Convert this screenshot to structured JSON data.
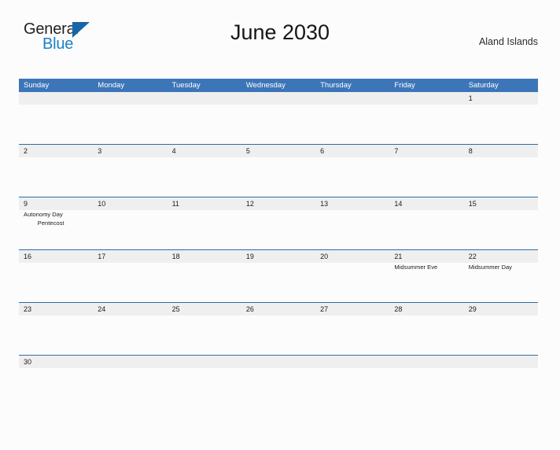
{
  "brand": {
    "name_part1": "General",
    "name_part2": "Blue",
    "triangle_color": "#1566a8",
    "blue_color": "#1c7fc4"
  },
  "header": {
    "title": "June 2030",
    "region": "Aland Islands"
  },
  "theme": {
    "header_blue": "#3d76b8",
    "rule_blue": "#2e6da4",
    "date_strip_gray": "#efefef",
    "page_background": "#fcfcfc"
  },
  "calendar": {
    "month": "June",
    "year": "2030",
    "weekday_headers": [
      "Sunday",
      "Monday",
      "Tuesday",
      "Wednesday",
      "Thursday",
      "Friday",
      "Saturday"
    ],
    "weeks": [
      {
        "days": [
          {
            "date": "",
            "events": []
          },
          {
            "date": "",
            "events": []
          },
          {
            "date": "",
            "events": []
          },
          {
            "date": "",
            "events": []
          },
          {
            "date": "",
            "events": []
          },
          {
            "date": "",
            "events": []
          },
          {
            "date": "1",
            "events": []
          }
        ]
      },
      {
        "days": [
          {
            "date": "2",
            "events": []
          },
          {
            "date": "3",
            "events": []
          },
          {
            "date": "4",
            "events": []
          },
          {
            "date": "5",
            "events": []
          },
          {
            "date": "6",
            "events": []
          },
          {
            "date": "7",
            "events": []
          },
          {
            "date": "8",
            "events": []
          }
        ]
      },
      {
        "days": [
          {
            "date": "9",
            "events": [
              "Autonomy Day",
              "Pentecost"
            ]
          },
          {
            "date": "10",
            "events": []
          },
          {
            "date": "11",
            "events": []
          },
          {
            "date": "12",
            "events": []
          },
          {
            "date": "13",
            "events": []
          },
          {
            "date": "14",
            "events": []
          },
          {
            "date": "15",
            "events": []
          }
        ]
      },
      {
        "days": [
          {
            "date": "16",
            "events": []
          },
          {
            "date": "17",
            "events": []
          },
          {
            "date": "18",
            "events": []
          },
          {
            "date": "19",
            "events": []
          },
          {
            "date": "20",
            "events": []
          },
          {
            "date": "21",
            "events": [
              "Midsummer Eve"
            ]
          },
          {
            "date": "22",
            "events": [
              "Midsummer Day"
            ]
          }
        ]
      },
      {
        "days": [
          {
            "date": "23",
            "events": []
          },
          {
            "date": "24",
            "events": []
          },
          {
            "date": "25",
            "events": []
          },
          {
            "date": "26",
            "events": []
          },
          {
            "date": "27",
            "events": []
          },
          {
            "date": "28",
            "events": []
          },
          {
            "date": "29",
            "events": []
          }
        ]
      },
      {
        "days": [
          {
            "date": "30",
            "events": []
          },
          {
            "date": "",
            "events": []
          },
          {
            "date": "",
            "events": []
          },
          {
            "date": "",
            "events": []
          },
          {
            "date": "",
            "events": []
          },
          {
            "date": "",
            "events": []
          },
          {
            "date": "",
            "events": []
          }
        ]
      }
    ]
  }
}
